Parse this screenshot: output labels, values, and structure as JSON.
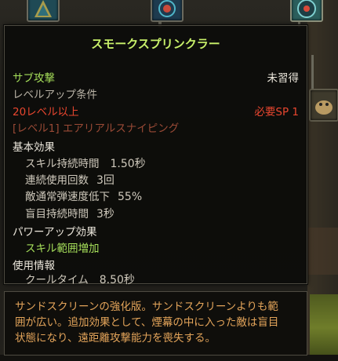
{
  "tooltip": {
    "title": "スモークスプリンクラー",
    "category": "サブ攻撃",
    "status": "未習得",
    "levelup": {
      "heading": "レベルアップ条件",
      "requirement": "20レベル以上",
      "required_sp": "必要SP 1",
      "prerequisite": "[レベル1] エアリアルスナイピング"
    },
    "basic": {
      "heading": "基本効果",
      "items": [
        {
          "label": "スキル持続時間",
          "value": "1.50秒"
        },
        {
          "label": "連続使用回数",
          "value": "3回"
        },
        {
          "label": "敵通常弾速度低下",
          "value": "55%"
        },
        {
          "label": "盲目持続時間",
          "value": "3秒"
        }
      ]
    },
    "powerup": {
      "heading": "パワーアップ効果",
      "item": "スキル範囲増加"
    },
    "usage": {
      "heading": "使用情報",
      "cooldown_label": "クールタイム",
      "cooldown_value": "8.50秒"
    }
  },
  "description": {
    "lines": [
      "サンドスクリーンの強化版。サンドスクリーンよりも範",
      "囲が広い。追加効果として、煙幕の中に入った敵は盲目",
      "状態になり、遠距離攻撃能力を喪失する。"
    ]
  },
  "colors": {
    "title": "#c8f06a",
    "category": "#a6df5a",
    "requirement": "#e8462f",
    "description": "#e3a45a"
  }
}
